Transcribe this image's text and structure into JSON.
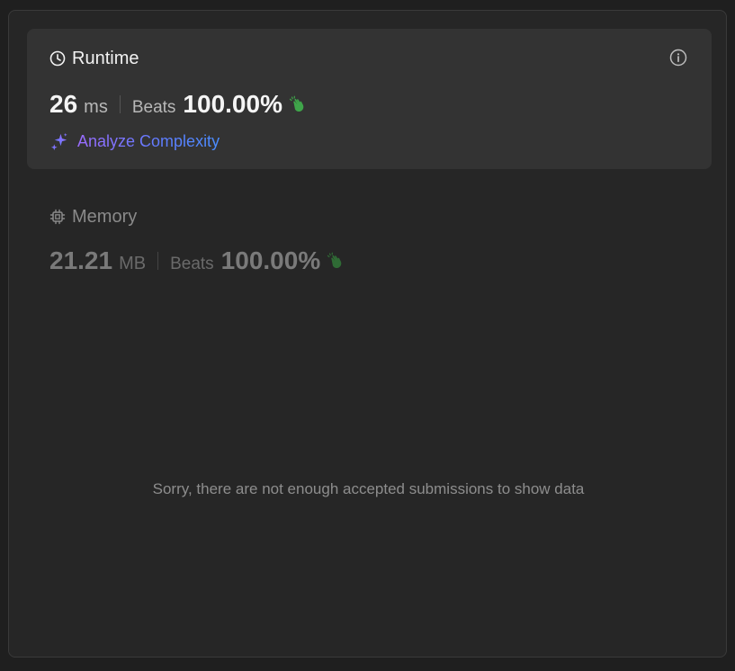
{
  "runtime": {
    "title": "Runtime",
    "value": "26",
    "unit": "ms",
    "beats_label": "Beats",
    "beats_value": "100.00%",
    "analyze_label": "Analyze Complexity"
  },
  "memory": {
    "title": "Memory",
    "value": "21.21",
    "unit": "MB",
    "beats_label": "Beats",
    "beats_value": "100.00%"
  },
  "empty_message": "Sorry, there are not enough accepted submissions to show data",
  "icons": {
    "runtime": "clock-icon",
    "info": "info-icon",
    "beats": "clapping-hands-icon",
    "analyze": "sparkle-icon",
    "memory": "chip-icon"
  },
  "colors": {
    "accent_green": "#3fa54a",
    "analyze_gradient_start": "#9b6cff",
    "analyze_gradient_end": "#4a8dff"
  }
}
